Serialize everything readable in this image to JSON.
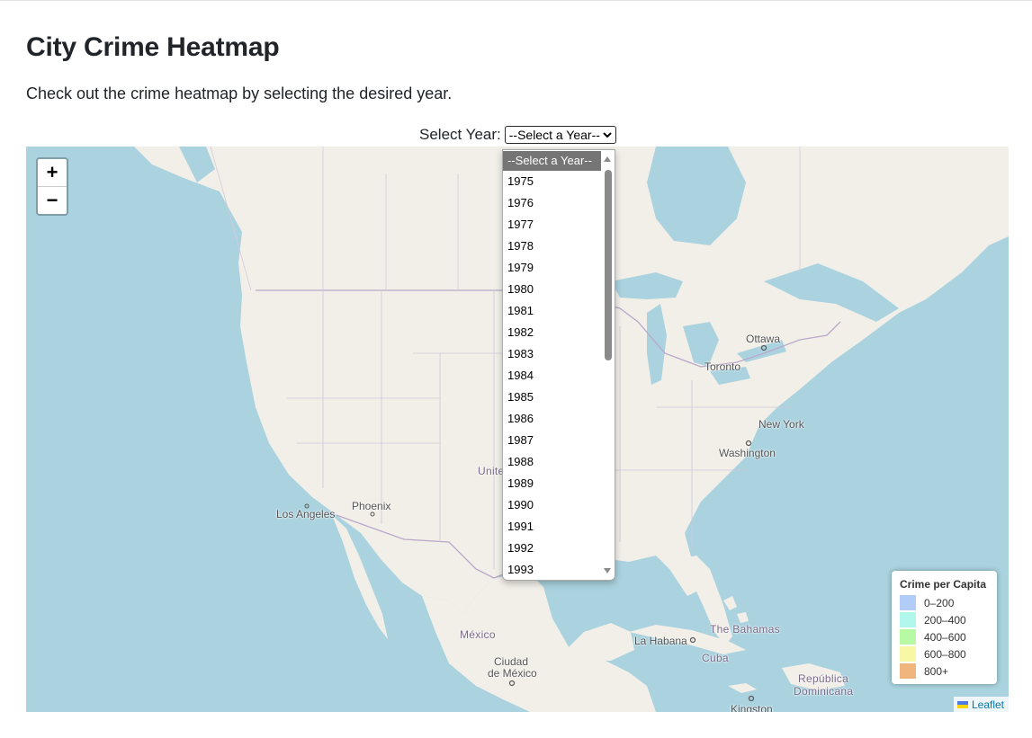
{
  "page": {
    "title": "City Crime Heatmap",
    "subtitle": "Check out the crime heatmap by selecting the desired year."
  },
  "year_select": {
    "label": "Select Year:",
    "selected": "--Select a Year--",
    "options": [
      "--Select a Year--",
      "1975",
      "1976",
      "1977",
      "1978",
      "1979",
      "1980",
      "1981",
      "1982",
      "1983",
      "1984",
      "1985",
      "1986",
      "1987",
      "1988",
      "1989",
      "1990",
      "1991",
      "1992",
      "1993"
    ]
  },
  "map": {
    "zoom_in": "+",
    "zoom_out": "−",
    "places": {
      "ottawa": "Ottawa",
      "toronto": "Toronto",
      "new_york": "New York",
      "washington": "Washington",
      "los_angeles": "Los Angeles",
      "phoenix": "Phoenix",
      "united": "Unite",
      "mexico": "México",
      "ciudad": "Ciudad",
      "de_mexico": "de México",
      "la_habana": "La Habana",
      "bahamas": "The Bahamas",
      "cuba": "Cuba",
      "republica": "República",
      "dominicana": "Dominicana",
      "kingston": "Kingston"
    },
    "attribution": "Leaflet"
  },
  "legend": {
    "title": "Crime per Capita",
    "items": [
      {
        "label": "0–200",
        "color": "#9ec0f5"
      },
      {
        "label": "200–400",
        "color": "#9ef5e6"
      },
      {
        "label": "400–600",
        "color": "#a6f78c"
      },
      {
        "label": "600–800",
        "color": "#f5f58f"
      },
      {
        "label": "800+",
        "color": "#eba25b"
      }
    ]
  },
  "colors": {
    "water": "#aad3df",
    "land": "#f2efe9",
    "border": "#b9a8c9"
  }
}
